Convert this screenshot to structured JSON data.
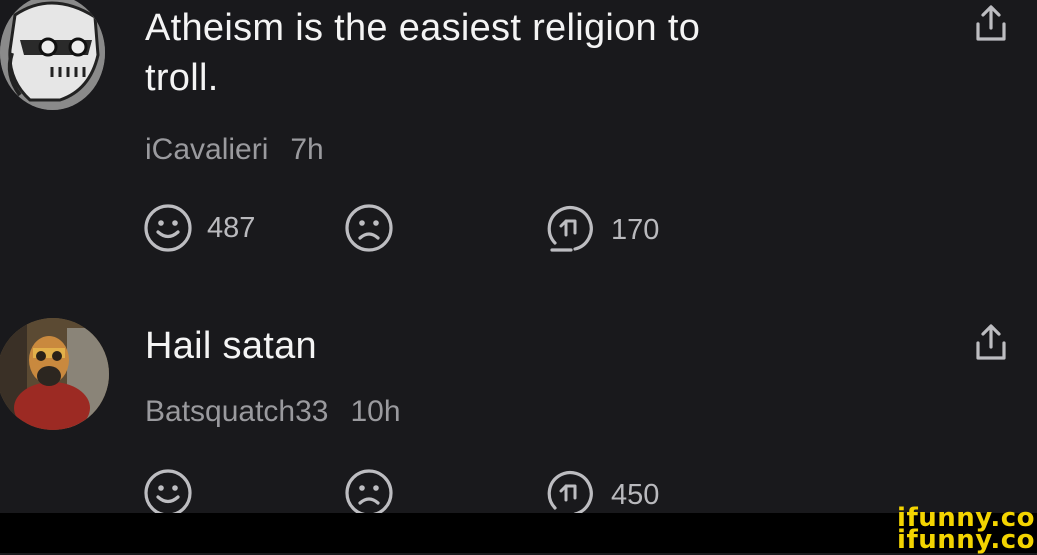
{
  "comments": [
    {
      "text_line1": "Atheism is the easiest religion to",
      "text_line2": "troll.",
      "username": "iCavalieri",
      "time": "7h",
      "smiles": "487",
      "frowns": "",
      "replies": "170"
    },
    {
      "text_line1": "Hail satan",
      "username": "Batsquatch33",
      "time": "10h",
      "smiles": "",
      "frowns": "",
      "replies": "450"
    }
  ],
  "watermark": {
    "line1": "ifunny.co",
    "line2": "ifunny.co",
    "color": "#f3d400"
  },
  "icons": [
    "avatar-knight",
    "avatar-person",
    "share-icon",
    "smile-icon",
    "frown-icon",
    "reply-icon"
  ]
}
